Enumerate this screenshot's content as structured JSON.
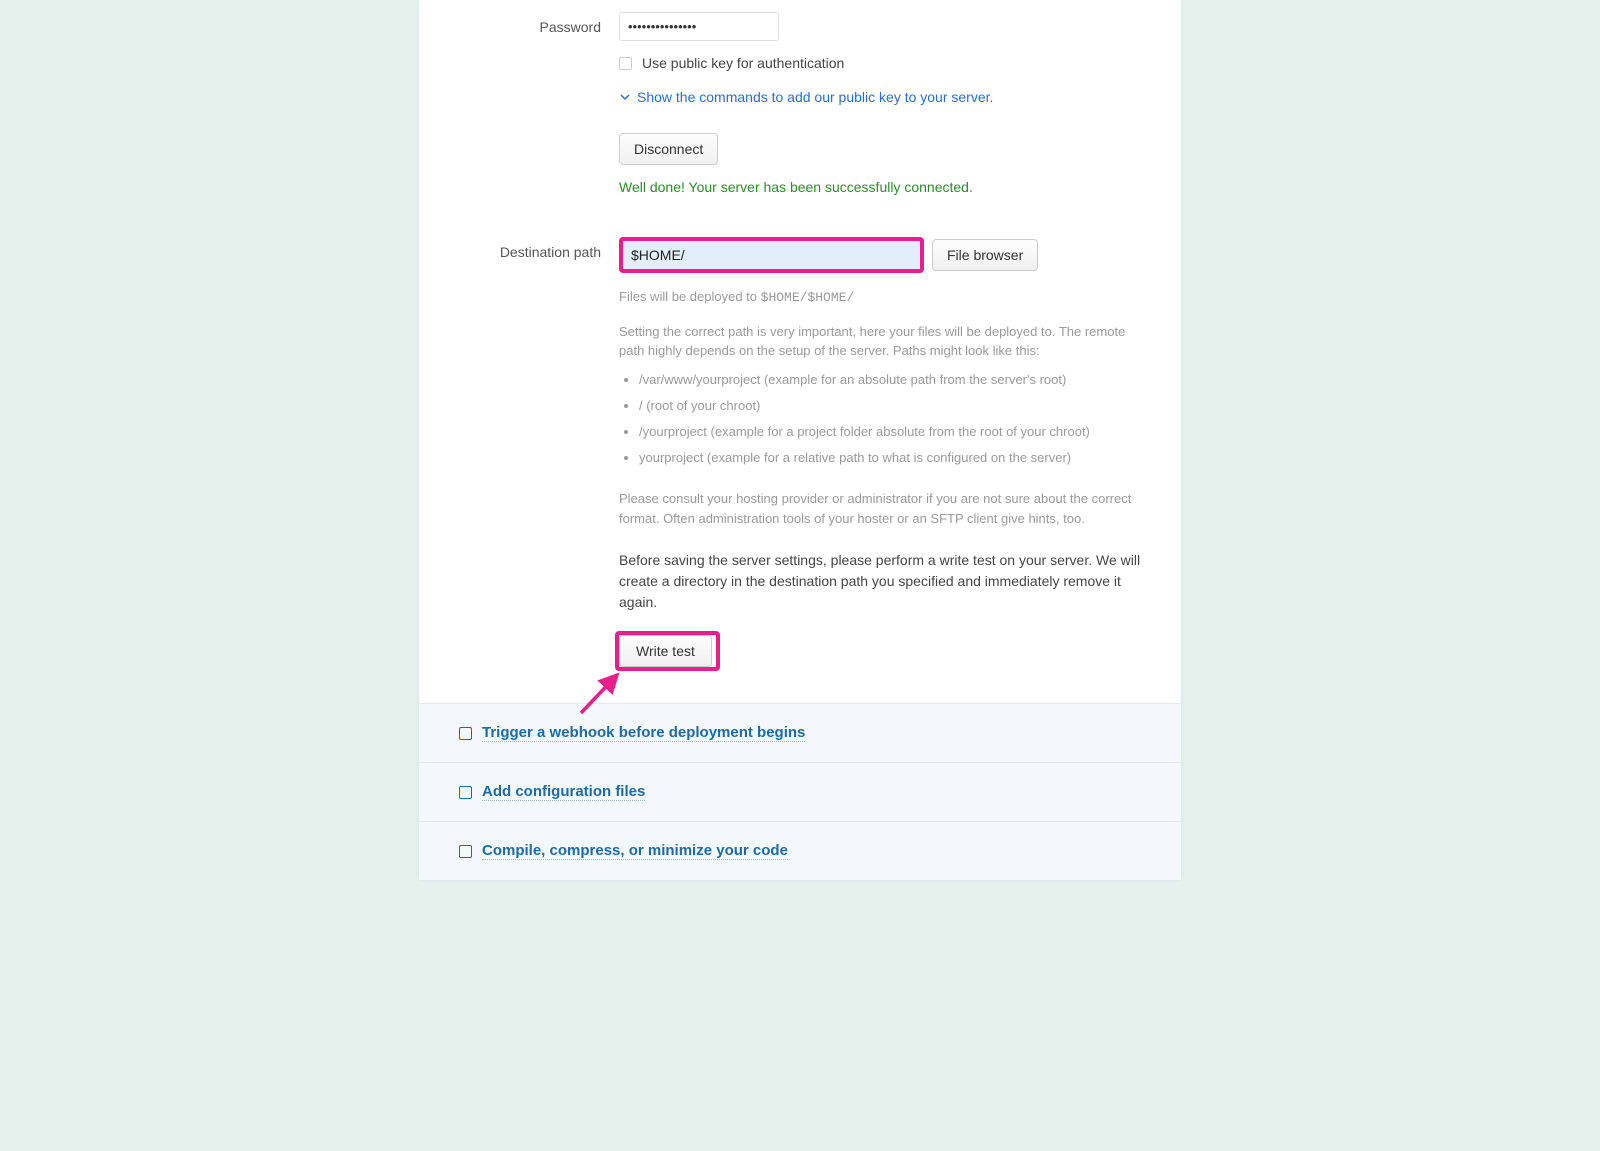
{
  "form": {
    "password_label": "Password",
    "password_value": "•••••••••••••••",
    "public_key_checkbox_label": "Use public key for authentication",
    "show_commands_link": "Show the commands to add our public key to your server.",
    "disconnect_label": "Disconnect",
    "success_message": "Well done! Your server has been successfully connected.",
    "destination_label": "Destination path",
    "destination_value": "$HOME/",
    "file_browser_label": "File browser",
    "deploy_hint_prefix": "Files will be deployed to ",
    "deploy_hint_code": "$HOME/$HOME/",
    "path_desc": "Setting the correct path is very important, here your files will be deployed to. The remote path highly depends on the setup of the server. Paths might look like this:",
    "path_examples": [
      "/var/www/yourproject (example for an absolute path from the server's root)",
      "/ (root of your chroot)",
      "/yourproject (example for a project folder absolute from the root of your chroot)",
      "yourproject (example for a relative path to what is configured on the server)"
    ],
    "consult_text": "Please consult your hosting provider or administrator if you are not sure about the correct format. Often administration tools of your hoster or an SFTP client give hints, too.",
    "write_test_desc": "Before saving the server settings, please perform a write test on your server. We will create a directory in the destination path you specified and immediately remove it again.",
    "write_test_label": "Write test"
  },
  "accordion": {
    "items": [
      {
        "label": "Trigger a webhook before deployment begins"
      },
      {
        "label": "Add configuration files"
      },
      {
        "label": "Compile, compress, or minimize your code"
      }
    ]
  }
}
